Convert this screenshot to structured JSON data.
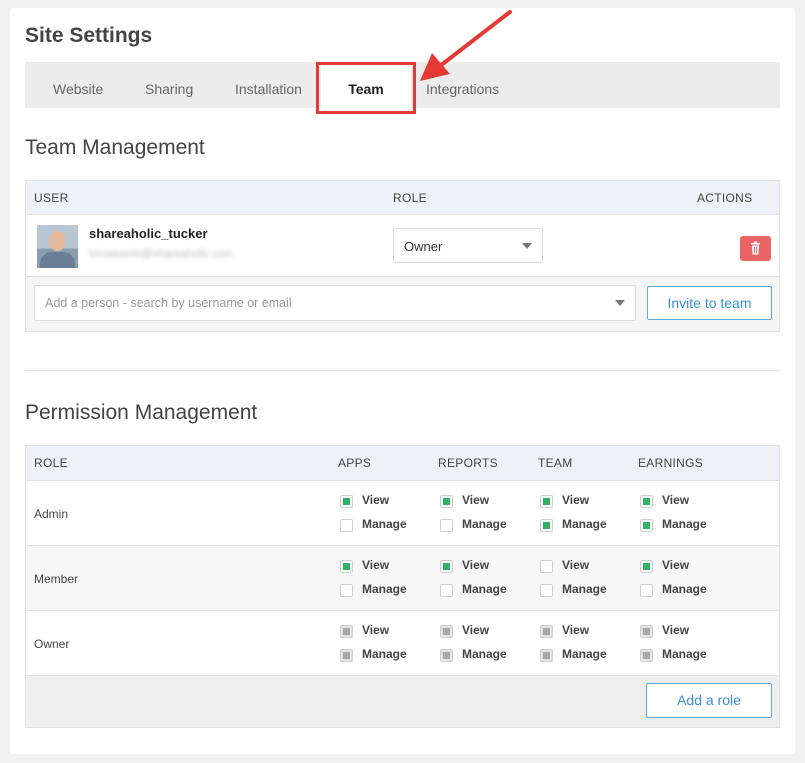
{
  "page": {
    "title": "Site Settings"
  },
  "tabs": [
    "Website",
    "Sharing",
    "Installation",
    "Team",
    "Integrations"
  ],
  "active_tab": "Team",
  "team": {
    "title": "Team Management",
    "headers": {
      "user": "USER",
      "role": "ROLE",
      "actions": "ACTIONS"
    },
    "members": [
      {
        "username": "shareaholic_tucker",
        "email": "tricialeonlo@shareaholic.com",
        "role": "Owner"
      }
    ],
    "add_placeholder": "Add a person - search by username or email",
    "invite_label": "Invite to team"
  },
  "permissions": {
    "title": "Permission Management",
    "headers": [
      "ROLE",
      "APPS",
      "REPORTS",
      "TEAM",
      "EARNINGS"
    ],
    "labels": {
      "view": "View",
      "manage": "Manage"
    },
    "rows": [
      {
        "role": "Admin",
        "cells": [
          {
            "view": true,
            "manage": false
          },
          {
            "view": true,
            "manage": false
          },
          {
            "view": true,
            "manage": true
          },
          {
            "view": true,
            "manage": true
          }
        ]
      },
      {
        "role": "Member",
        "cells": [
          {
            "view": true,
            "manage": false
          },
          {
            "view": true,
            "manage": false
          },
          {
            "view": false,
            "manage": false
          },
          {
            "view": true,
            "manage": false
          }
        ]
      },
      {
        "role": "Owner",
        "disabled": true,
        "cells": [
          {
            "view": true,
            "manage": true
          },
          {
            "view": true,
            "manage": true
          },
          {
            "view": true,
            "manage": true
          },
          {
            "view": true,
            "manage": true
          }
        ]
      }
    ],
    "add_role_label": "Add a role"
  },
  "colors": {
    "accent": "#3b8fd4",
    "danger": "#e96464",
    "checked": "#2fb261",
    "annotation": "#e53935"
  }
}
